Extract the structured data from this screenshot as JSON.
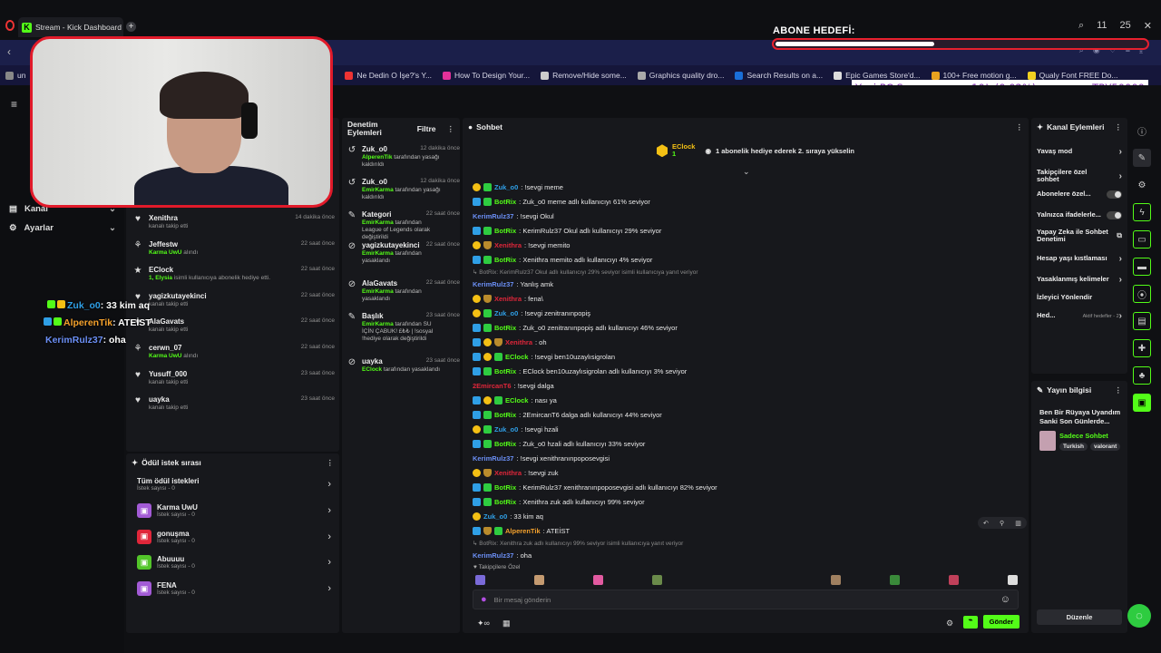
{
  "browser": {
    "tab_title": "Stream - Kick Dashboard",
    "tab_favicon": "K",
    "new_tab": "+",
    "clock": "11",
    "clock2": "25",
    "bookmarks": [
      {
        "label": "un",
        "color": "#888"
      },
      {
        "label": "Ne Dedin O İşe?'s Y...",
        "color": "#e33"
      },
      {
        "label": "How To Design Your...",
        "color": "#e3319a"
      },
      {
        "label": "Remove/Hide some...",
        "color": "#ccc"
      },
      {
        "label": "Graphics quality dro...",
        "color": "#aaa"
      },
      {
        "label": "Search Results on a...",
        "color": "#1a6fd8"
      },
      {
        "label": "Epic Games Store'd...",
        "color": "#ddd"
      },
      {
        "label": "100+ Free motion g...",
        "color": "#e8a21f"
      },
      {
        "label": "Qualy Font FREE Do...",
        "color": "#f0d020"
      }
    ]
  },
  "overlay": {
    "goal_title": "ABONE HEDEFİ:",
    "goal_progress": 0.43,
    "ticker_left": "Yeni PC Sex",
    "ticker_mid": "10₺ (0.02%)",
    "ticker_right": "TRY50000",
    "chat_lines": [
      {
        "user": "Zuk_o0",
        "text": ": 33 kim aq",
        "color": "#2f9fe6"
      },
      {
        "user": "AlperenTik",
        "text": ": ATEİST",
        "color": "#f4a12c"
      },
      {
        "user": "KerimRulz37",
        "text": ": oha",
        "color": "#6b8ff5"
      }
    ]
  },
  "leftnav": {
    "items": [
      {
        "label": "Kanal",
        "icon": "channel-icon"
      },
      {
        "label": "Ayarlar",
        "icon": "gear-icon"
      }
    ]
  },
  "activity": [
    {
      "name": "Xenithra",
      "sub": "kanalı takip etti",
      "time": "14 dakika önce",
      "icon": "heart-icon"
    },
    {
      "name": "Jeffestw",
      "sub": "Karma UwU",
      "sub2": "alındı",
      "time": "22 saat önce",
      "icon": "gift-icon"
    },
    {
      "name": "EClock",
      "sub": "1, Elysia",
      "sub2": "isimli kullanıcıya abonelik hediye etti.",
      "time": "22 saat önce",
      "icon": "sub-icon"
    },
    {
      "name": "yagizkutayekinci",
      "sub": "kanalı takip etti",
      "time": "22 saat önce",
      "icon": "heart-icon"
    },
    {
      "name": "AlaGavats",
      "sub": "kanalı takip etti",
      "time": "22 saat önce",
      "icon": "heart-icon"
    },
    {
      "name": "cerwn_07",
      "sub": "Karma UwU",
      "sub2": "alındı",
      "time": "22 saat önce",
      "icon": "gift-icon"
    },
    {
      "name": "Yusuff_000",
      "sub": "kanalı takip etti",
      "time": "23 saat önce",
      "icon": "heart-icon"
    },
    {
      "name": "uayka",
      "sub": "kanalı takip etti",
      "time": "23 saat önce",
      "icon": "heart-icon"
    }
  ],
  "rewards": {
    "title": "Ödül istek sırası",
    "all_label": "Tüm ödül istekleri",
    "all_count": "İstek sayısı - 0",
    "items": [
      {
        "name": "Karma UwU",
        "count": "İstek sayısı - 0",
        "color": "#a35bd6"
      },
      {
        "name": "gonuşma",
        "count": "İstek sayısı - 0",
        "color": "#e0263a"
      },
      {
        "name": "Abuuuu",
        "count": "İstek sayısı - 0",
        "color": "#53c52a"
      },
      {
        "name": "FENA",
        "count": "İstek sayısı - 0",
        "color": "#a35bd6"
      }
    ]
  },
  "moderation": {
    "title": "Denetim Eylemleri",
    "filter": "Filtre",
    "rows": [
      {
        "name": "Zuk_o0",
        "time": "12 dakika önce",
        "actor": "AlperenTik",
        "text": "tarafından yasağı kaldırıldı",
        "icon": "undo-icon"
      },
      {
        "name": "Zuk_o0",
        "time": "12 dakika önce",
        "actor": "EmirKarma",
        "text": "tarafından yasağı kaldırıldı",
        "icon": "undo-icon"
      },
      {
        "name": "Kategori",
        "time": "22 saat önce",
        "actor": "EmirKarma",
        "text": "tarafından League of Legends olarak değiştirildi",
        "icon": "edit-icon"
      },
      {
        "name": "yagizkutayekinci",
        "time": "22 saat önce",
        "actor": "EmirKarma",
        "text": "tarafından yasaklandı",
        "icon": "ban-icon"
      },
      {
        "name": "AlaGavats",
        "time": "22 saat önce",
        "actor": "EmirKarma",
        "text": "tarafından yasaklandı",
        "icon": "ban-icon"
      },
      {
        "name": "Başlık",
        "time": "23 saat önce",
        "actor": "EmirKarma",
        "text": "tarafından SU İÇİN ÇABUK! £₺₺ | !sosyal !hediye olarak değiştirildi",
        "icon": "edit-icon"
      },
      {
        "name": "uayka",
        "time": "23 saat önce",
        "actor": "EClock",
        "text": "tarafından yasaklandı",
        "icon": "ban-icon"
      }
    ]
  },
  "chat": {
    "title": "Sohbet",
    "pinned_user": "EClock",
    "pinned_count": "1",
    "pinned_text": "1 abonelik hediye ederek 2. sıraya yükselin",
    "messages": [
      {
        "user": "Zuk_o0",
        "ucolor": "#2f9fe6",
        "text": ": !sevgi meme",
        "badges": [
          "gold",
          "green"
        ]
      },
      {
        "user": "BotRix",
        "ucolor": "#53fc18",
        "text": ": Zuk_o0 meme adlı kullanıcıyı 61% seviyor",
        "badges": [
          "blue",
          "green"
        ]
      },
      {
        "user": "KerimRulz37",
        "ucolor": "#6b8ff5",
        "text": ": !sevgi Okul",
        "badges": []
      },
      {
        "user": "BotRix",
        "ucolor": "#53fc18",
        "text": ": KerimRulz37 Okul adlı kullanıcıyı 29% seviyor",
        "badges": [
          "blue",
          "green"
        ]
      },
      {
        "user": "Xenithra",
        "ucolor": "#e0263a",
        "text": ": !sevgi memito",
        "badges": [
          "gold",
          "shield"
        ]
      },
      {
        "user": "BotRix",
        "ucolor": "#53fc18",
        "text": ": Xenithra memito adlı kullanıcıyı 4% seviyor",
        "badges": [
          "blue",
          "green"
        ]
      },
      {
        "reply": "BotRix: KerimRulz37 Okul adlı kullanıcıyı 29% seviyor isimli kullanıcıya yanıt veriyor"
      },
      {
        "user": "KerimRulz37",
        "ucolor": "#6b8ff5",
        "text": ": Yanlış amk",
        "badges": []
      },
      {
        "user": "Xenithra",
        "ucolor": "#e0263a",
        "text": ": fena\\",
        "badges": [
          "gold",
          "shield"
        ]
      },
      {
        "user": "Zuk_o0",
        "ucolor": "#2f9fe6",
        "text": ": !sevgi zenitranınpopiş",
        "badges": [
          "gold",
          "green"
        ]
      },
      {
        "user": "BotRix",
        "ucolor": "#53fc18",
        "text": ": Zuk_o0 zenitranınpopiş adlı kullanıcıyı 46% seviyor",
        "badges": [
          "blue",
          "green"
        ]
      },
      {
        "user": "Xenithra",
        "ucolor": "#e0263a",
        "text": ": oh",
        "badges": [
          "blue",
          "gold",
          "shield"
        ]
      },
      {
        "user": "EClock",
        "ucolor": "#53fc18",
        "text": ": !sevgi ben10uzaylısigrolan",
        "badges": [
          "blue",
          "gold",
          "green"
        ]
      },
      {
        "user": "BotRix",
        "ucolor": "#53fc18",
        "text": ": EClock ben10uzaylısigrolan adlı kullanıcıyı 3% seviyor",
        "badges": [
          "blue",
          "green"
        ]
      },
      {
        "user": "2EmircanT6",
        "ucolor": "#e0263a",
        "text": ": !sevgi dalga",
        "badges": []
      },
      {
        "user": "EClock",
        "ucolor": "#53fc18",
        "text": ": nası ya",
        "badges": [
          "blue",
          "gold",
          "green"
        ]
      },
      {
        "user": "BotRix",
        "ucolor": "#53fc18",
        "text": ": 2EmircanT6 dalga adlı kullanıcıyı 44% seviyor",
        "badges": [
          "blue",
          "green"
        ]
      },
      {
        "user": "Zuk_o0",
        "ucolor": "#2f9fe6",
        "text": ": !sevgi hzali",
        "badges": [
          "gold",
          "green"
        ]
      },
      {
        "user": "BotRix",
        "ucolor": "#53fc18",
        "text": ": Zuk_o0 hzali adlı kullanıcıyı 33% seviyor",
        "badges": [
          "blue",
          "green"
        ]
      },
      {
        "user": "KerimRulz37",
        "ucolor": "#6b8ff5",
        "text": ": !sevgi xenithranınpoposevgisi",
        "badges": []
      },
      {
        "user": "Xenithra",
        "ucolor": "#e0263a",
        "text": ": !sevgi zuk",
        "badges": [
          "gold",
          "shield"
        ]
      },
      {
        "user": "BotRix",
        "ucolor": "#53fc18",
        "text": ": KerimRulz37 xenithranınpoposevgisi adlı kullanıcıyı 82% seviyor",
        "badges": [
          "blue",
          "green"
        ]
      },
      {
        "user": "BotRix",
        "ucolor": "#53fc18",
        "text": ": Xenithra zuk adlı kullanıcıyı 99% seviyor",
        "badges": [
          "blue",
          "green"
        ]
      },
      {
        "user": "Zuk_o0",
        "ucolor": "#2f9fe6",
        "text": ": 33 kim aq",
        "badges": [
          "gold"
        ]
      },
      {
        "user": "AlperenTik",
        "ucolor": "#f4a12c",
        "text": ": ATEİST",
        "badges": [
          "blue",
          "shield",
          "green"
        ]
      },
      {
        "reply": "BotRix: Xenithra zuk adlı kullanıcıyı 99% seviyor isimli kullanıcıya yanıt veriyor"
      },
      {
        "user": "KerimRulz37",
        "ucolor": "#6b8ff5",
        "text": ": oha",
        "badges": []
      }
    ],
    "emote_label": "Takipçilere Özel",
    "input_placeholder": "Bir mesaj gönderin",
    "send_label": "Gönder"
  },
  "channel_actions": {
    "title": "Kanal Eylemleri",
    "rows": [
      {
        "label": "Yavaş mod",
        "control": "chevron"
      },
      {
        "label": "Takipçilere özel sohbet",
        "control": "chevron"
      },
      {
        "label": "Abonelere özel...",
        "control": "toggle"
      },
      {
        "label": "Yalnızca ifadelerle...",
        "control": "toggle"
      },
      {
        "label": "Yapay Zeka ile Sohbet Denetimi",
        "control": "ext"
      },
      {
        "label": "Hesap yaşı kıstlaması",
        "control": "chevron"
      },
      {
        "label": "Yasaklanmış kelimeler",
        "control": "chevron"
      },
      {
        "label": "İzleyici Yönlendir",
        "control": "none"
      },
      {
        "label": "Hed...",
        "sub": "Aktif hedefler - 2",
        "control": "chevron"
      }
    ]
  },
  "stream_info": {
    "title": "Yayın bilgisi",
    "stream_title": "Ben Bir Rüyaya Uyandım Sanki Son Günlerde...",
    "category": "Sadece Sohbet",
    "tags": [
      "Turkish",
      "valorant"
    ],
    "edit_label": "Düzenle"
  }
}
